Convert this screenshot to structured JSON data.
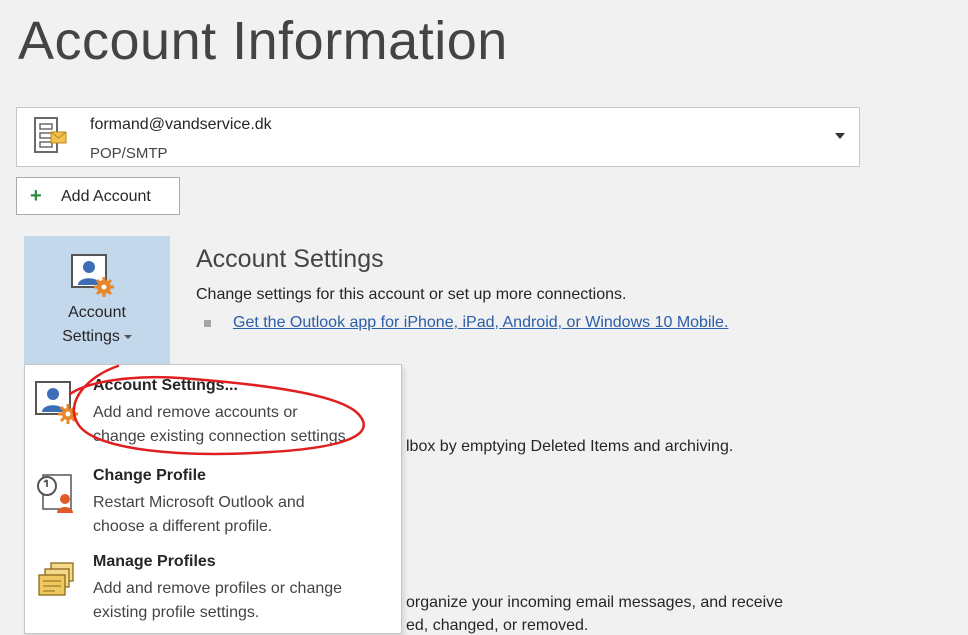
{
  "page": {
    "title": "Account Information"
  },
  "account_selector": {
    "email": "formand@vandservice.dk",
    "type": "POP/SMTP",
    "icon": "mail-account-icon",
    "dropdown_icon": "caret-down-icon"
  },
  "add_account": {
    "label": "Add Account",
    "icon": "plus-icon"
  },
  "account_settings_button": {
    "line1": "Account",
    "line2": "Settings",
    "icon": "account-settings-icon"
  },
  "account_settings_section": {
    "title": "Account Settings",
    "description": "Change settings for this account or set up more connections.",
    "link": "Get the Outlook app for iPhone, iPad, Android, or Windows 10 Mobile."
  },
  "background_text": {
    "mailbox_partial": "lbox by emptying Deleted Items and archiving.",
    "rules_partial_1": "organize your incoming email messages, and receive",
    "rules_partial_2": "ed, changed, or removed."
  },
  "dropdown_menu": {
    "items": [
      {
        "title": "Account Settings...",
        "desc1": "Add and remove accounts or",
        "desc2": "change existing connection settings.",
        "icon": "account-settings-icon"
      },
      {
        "title": "Change Profile",
        "desc1": "Restart Microsoft Outlook and",
        "desc2": "choose a different profile.",
        "icon": "change-profile-icon"
      },
      {
        "title": "Manage Profiles",
        "desc1": "Add and remove profiles or change",
        "desc2": "existing profile settings.",
        "icon": "manage-profiles-icon"
      }
    ]
  },
  "colors": {
    "accent_button_bg": "#c4d8ec",
    "link": "#2a5ea8",
    "annotation": "#e02020",
    "settings_gear": "#e8862a"
  }
}
